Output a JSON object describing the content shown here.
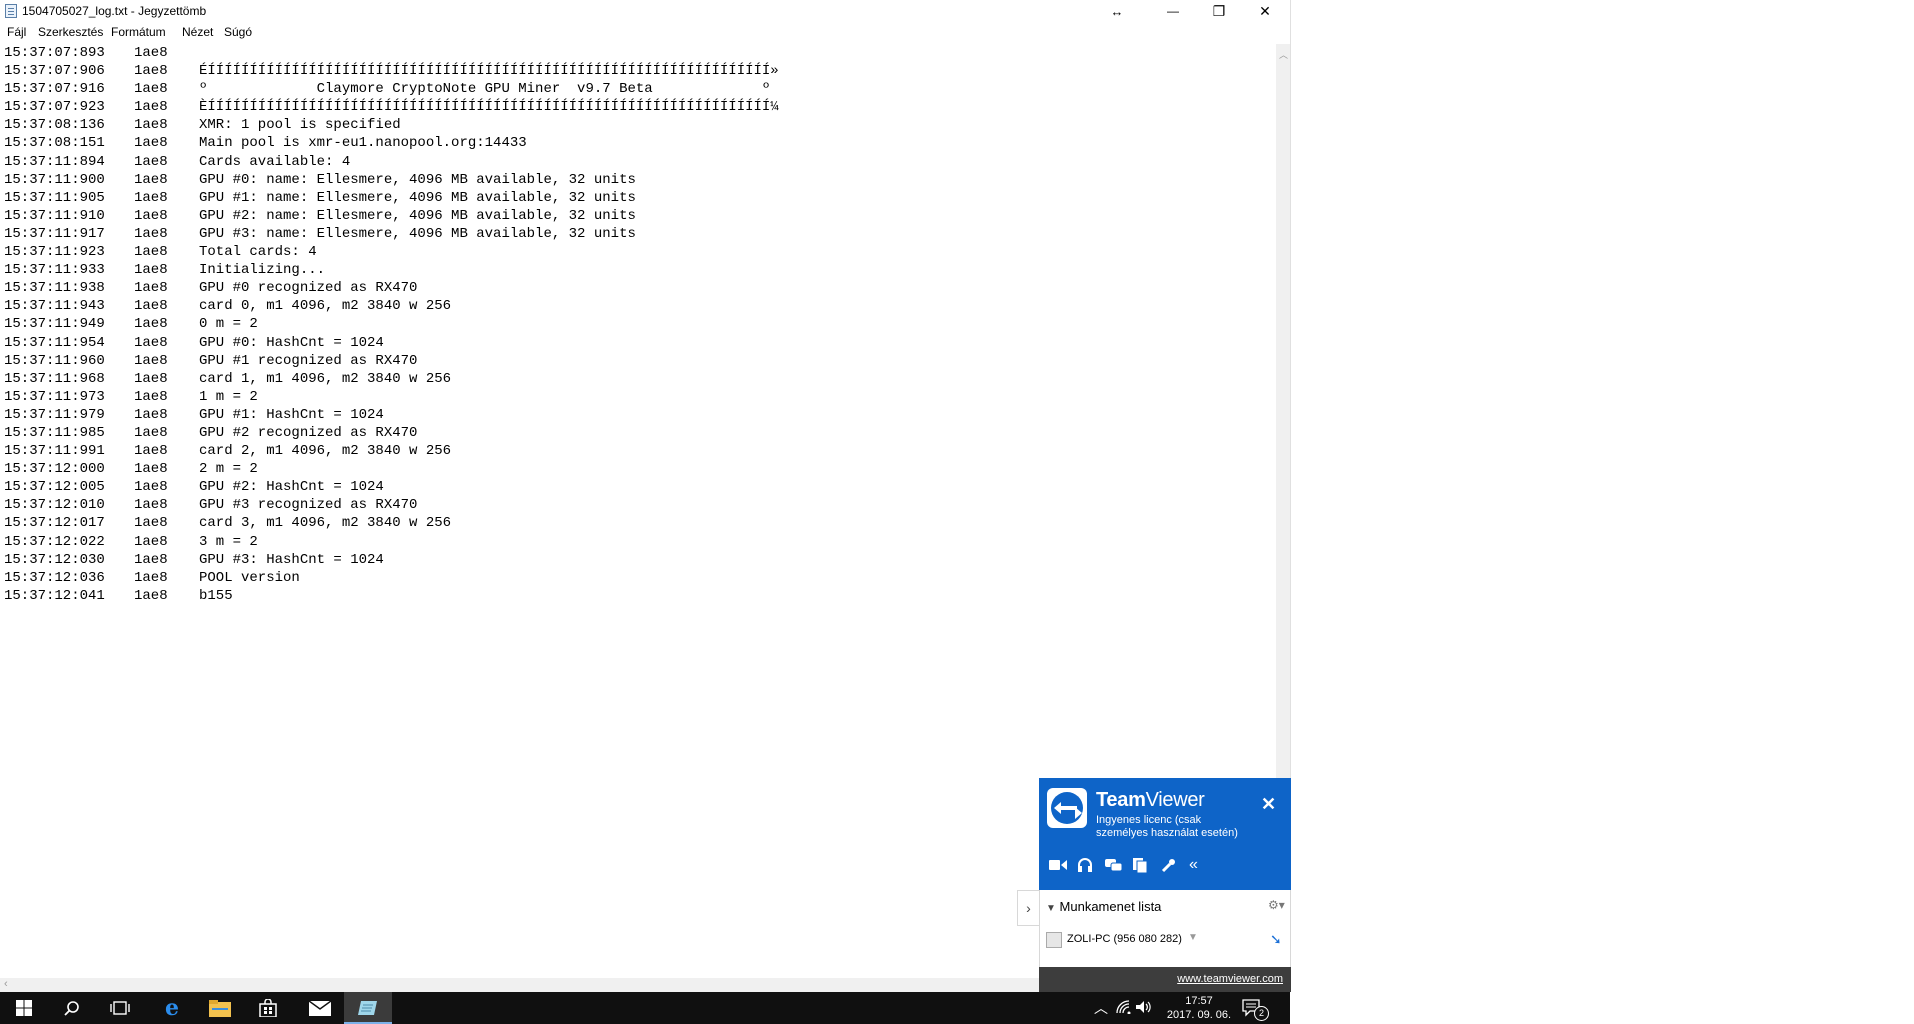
{
  "window": {
    "title": "1504705027_log.txt - Jegyzettömb",
    "controls": {
      "resize": "↔",
      "minimize": "—",
      "restore": "❐",
      "close": "✕"
    }
  },
  "menu": [
    "Fájl",
    "Szerkesztés",
    "Formátum",
    "Nézet",
    "Súgó"
  ],
  "log_lines": [
    {
      "ts": "15:37:07:893",
      "tid": "1ae8",
      "msg": ""
    },
    {
      "ts": "15:37:07:906",
      "tid": "1ae8",
      "msg": "ÉÍÍÍÍÍÍÍÍÍÍÍÍÍÍÍÍÍÍÍÍÍÍÍÍÍÍÍÍÍÍÍÍÍÍÍÍÍÍÍÍÍÍÍÍÍÍÍÍÍÍÍÍÍÍÍÍÍÍÍÍÍÍÍÍÍÍÍ»"
    },
    {
      "ts": "15:37:07:916",
      "tid": "1ae8",
      "msg": "º             Claymore CryptoNote GPU Miner  v9.7 Beta             º"
    },
    {
      "ts": "15:37:07:923",
      "tid": "1ae8",
      "msg": "ÈÍÍÍÍÍÍÍÍÍÍÍÍÍÍÍÍÍÍÍÍÍÍÍÍÍÍÍÍÍÍÍÍÍÍÍÍÍÍÍÍÍÍÍÍÍÍÍÍÍÍÍÍÍÍÍÍÍÍÍÍÍÍÍÍÍÍÍ¼"
    },
    {
      "ts": "15:37:08:136",
      "tid": "1ae8",
      "msg": "XMR: 1 pool is specified"
    },
    {
      "ts": "15:37:08:151",
      "tid": "1ae8",
      "msg": "Main pool is xmr-eu1.nanopool.org:14433"
    },
    {
      "ts": "15:37:11:894",
      "tid": "1ae8",
      "msg": "Cards available: 4"
    },
    {
      "ts": "15:37:11:900",
      "tid": "1ae8",
      "msg": "GPU #0: name: Ellesmere, 4096 MB available, 32 units"
    },
    {
      "ts": "15:37:11:905",
      "tid": "1ae8",
      "msg": "GPU #1: name: Ellesmere, 4096 MB available, 32 units"
    },
    {
      "ts": "15:37:11:910",
      "tid": "1ae8",
      "msg": "GPU #2: name: Ellesmere, 4096 MB available, 32 units"
    },
    {
      "ts": "15:37:11:917",
      "tid": "1ae8",
      "msg": "GPU #3: name: Ellesmere, 4096 MB available, 32 units"
    },
    {
      "ts": "15:37:11:923",
      "tid": "1ae8",
      "msg": "Total cards: 4"
    },
    {
      "ts": "15:37:11:933",
      "tid": "1ae8",
      "msg": "Initializing..."
    },
    {
      "ts": "15:37:11:938",
      "tid": "1ae8",
      "msg": "GPU #0 recognized as RX470"
    },
    {
      "ts": "15:37:11:943",
      "tid": "1ae8",
      "msg": "card 0, m1 4096, m2 3840 w 256"
    },
    {
      "ts": "15:37:11:949",
      "tid": "1ae8",
      "msg": "0 m = 2"
    },
    {
      "ts": "15:37:11:954",
      "tid": "1ae8",
      "msg": "GPU #0: HashCnt = 1024"
    },
    {
      "ts": "15:37:11:960",
      "tid": "1ae8",
      "msg": "GPU #1 recognized as RX470"
    },
    {
      "ts": "15:37:11:968",
      "tid": "1ae8",
      "msg": "card 1, m1 4096, m2 3840 w 256"
    },
    {
      "ts": "15:37:11:973",
      "tid": "1ae8",
      "msg": "1 m = 2"
    },
    {
      "ts": "15:37:11:979",
      "tid": "1ae8",
      "msg": "GPU #1: HashCnt = 1024"
    },
    {
      "ts": "15:37:11:985",
      "tid": "1ae8",
      "msg": "GPU #2 recognized as RX470"
    },
    {
      "ts": "15:37:11:991",
      "tid": "1ae8",
      "msg": "card 2, m1 4096, m2 3840 w 256"
    },
    {
      "ts": "15:37:12:000",
      "tid": "1ae8",
      "msg": "2 m = 2"
    },
    {
      "ts": "15:37:12:005",
      "tid": "1ae8",
      "msg": "GPU #2: HashCnt = 1024"
    },
    {
      "ts": "15:37:12:010",
      "tid": "1ae8",
      "msg": "GPU #3 recognized as RX470"
    },
    {
      "ts": "15:37:12:017",
      "tid": "1ae8",
      "msg": "card 3, m1 4096, m2 3840 w 256"
    },
    {
      "ts": "15:37:12:022",
      "tid": "1ae8",
      "msg": "3 m = 2"
    },
    {
      "ts": "15:37:12:030",
      "tid": "1ae8",
      "msg": "GPU #3: HashCnt = 1024"
    },
    {
      "ts": "15:37:12:036",
      "tid": "1ae8",
      "msg": "POOL version"
    },
    {
      "ts": "15:37:12:041",
      "tid": "1ae8",
      "msg": "b155"
    }
  ],
  "teamviewer": {
    "brand_bold": "Team",
    "brand_light": "Viewer",
    "subtitle": "Ingyenes licenc (csak személyes használat esetén)",
    "close": "✕",
    "session_list_title": "Munkamenet lista",
    "partner": "ZOLI-PC (956 080 282)",
    "link": "www.teamviewer.com",
    "accent_color": "#0e64c8"
  },
  "taskbar": {
    "time": "17:57",
    "date": "2017. 09. 06.",
    "notifications": "2"
  }
}
